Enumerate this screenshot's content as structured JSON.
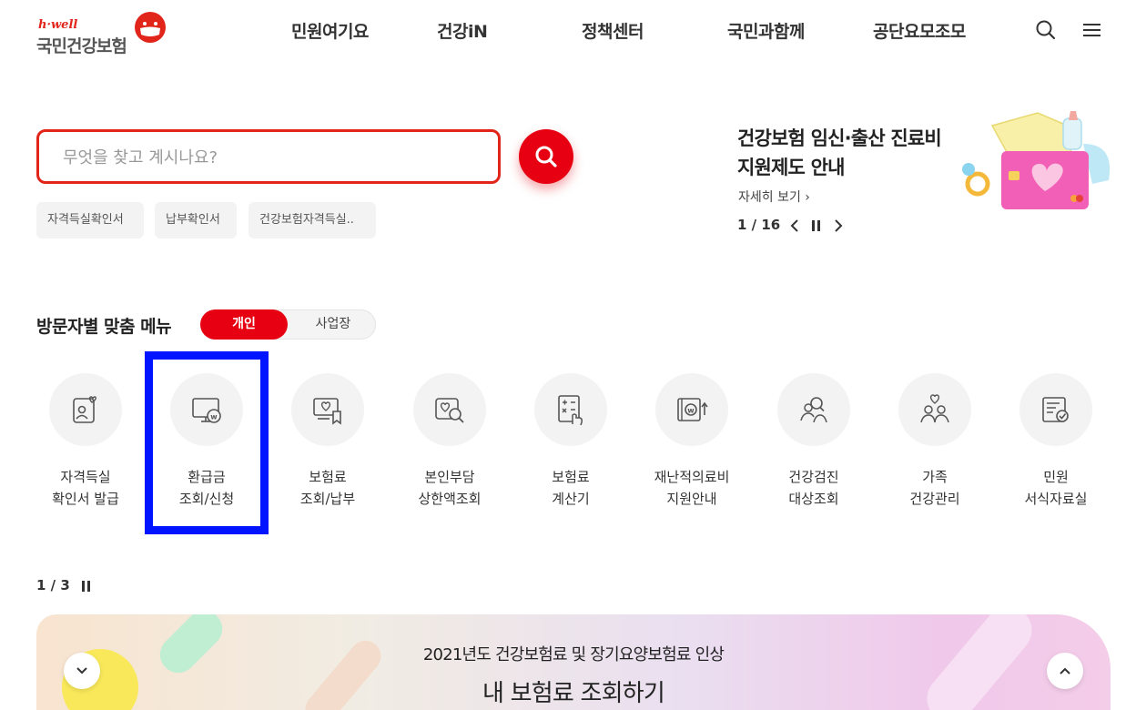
{
  "header": {
    "logo_tagline": "h·well",
    "logo_name": "국민건강보험",
    "nav": [
      {
        "label": "민원여기요"
      },
      {
        "label": "건강iN"
      },
      {
        "label": "정책센터"
      },
      {
        "label": "국민과함께"
      },
      {
        "label": "공단요모조모"
      }
    ],
    "icons": [
      "search-icon",
      "menu-icon"
    ]
  },
  "search": {
    "placeholder": "무엇을 찾고 계시나요?",
    "value": "",
    "chips": [
      {
        "label": "자격득실확인서"
      },
      {
        "label": "납부확인서"
      },
      {
        "label": "건강보험자격득실.."
      }
    ]
  },
  "promo": {
    "title_line1": "건강보험 임신·출산 진료비",
    "title_line2": "지원제도 안내",
    "more_label": "자세히 보기 ›",
    "page_current": "1",
    "page_total": "16",
    "page_label": "1 / 16"
  },
  "visitor_menu": {
    "heading": "방문자별 맞춤 메뉴",
    "segments": [
      {
        "label": "개인",
        "selected": true
      },
      {
        "label": "사업장",
        "selected": false
      }
    ],
    "items": [
      {
        "line1": "자격득실",
        "line2": "확인서 발급",
        "icon": "id-card-heart-icon"
      },
      {
        "line1": "환급금",
        "line2": "조회/신청",
        "icon": "monitor-won-icon"
      },
      {
        "line1": "보험료",
        "line2": "조회/납부",
        "icon": "bill-heart-icon"
      },
      {
        "line1": "본인부담",
        "line2": "상한액조회",
        "icon": "heart-search-icon"
      },
      {
        "line1": "보험료",
        "line2": "계산기",
        "icon": "calculator-icon"
      },
      {
        "line1": "재난적의료비",
        "line2": "지원안내",
        "icon": "wallet-won-icon"
      },
      {
        "line1": "건강검진",
        "line2": "대상조회",
        "icon": "people-search-icon"
      },
      {
        "line1": "가족",
        "line2": "건강관리",
        "icon": "family-heart-icon"
      },
      {
        "line1": "민원",
        "line2": "서식자료실",
        "icon": "document-check-icon"
      }
    ],
    "highlighted_index": 1,
    "page_label": "1 / 3"
  },
  "banner": {
    "subtitle": "2021년도 건강보험료 및 장기요양보험료 인상",
    "title": "내 보험료 조회하기"
  },
  "colors": {
    "brand_red": "#e60012",
    "highlight_blue": "#0014ff",
    "chip_bg": "#f3f3f3"
  }
}
